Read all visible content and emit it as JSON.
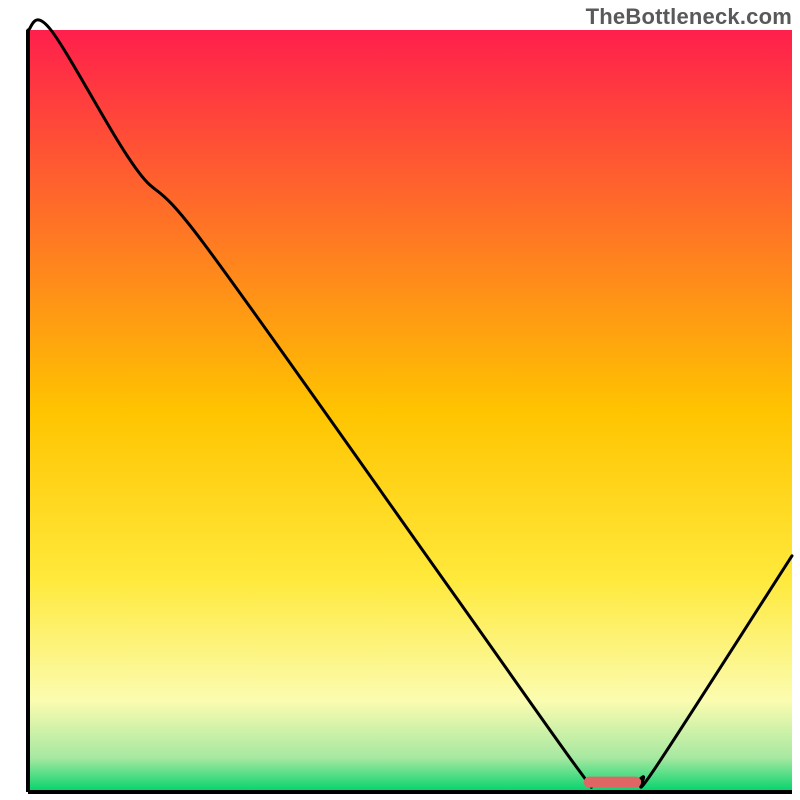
{
  "watermark": "TheBottleneck.com",
  "chart_data": {
    "type": "line",
    "title": "",
    "xlabel": "",
    "ylabel": "",
    "xlim": [
      0,
      100
    ],
    "ylim": [
      0,
      100
    ],
    "background": {
      "gradient_type": "vertical",
      "stops": [
        {
          "offset": 0.0,
          "color": "#ff1f4c"
        },
        {
          "offset": 0.5,
          "color": "#ffc400"
        },
        {
          "offset": 0.72,
          "color": "#ffe93b"
        },
        {
          "offset": 0.88,
          "color": "#fbfcb0"
        },
        {
          "offset": 0.955,
          "color": "#a7e8a1"
        },
        {
          "offset": 1.0,
          "color": "#00d36b"
        }
      ]
    },
    "curve": {
      "name": "bottleneck-curve",
      "x": [
        0,
        3,
        14,
        23,
        55,
        72,
        74,
        79,
        80.5,
        82,
        100
      ],
      "y": [
        100,
        100,
        82,
        72,
        27,
        3,
        1.3,
        1.3,
        2.0,
        3.0,
        31
      ]
    },
    "marker": {
      "shape": "rounded-bar",
      "x_center": 76.5,
      "width": 7.5,
      "y": 1.3,
      "color": "#e06666"
    },
    "axes": {
      "left": {
        "visible": true,
        "color": "#000000",
        "ticks": []
      },
      "bottom": {
        "visible": true,
        "color": "#000000",
        "ticks": []
      }
    }
  }
}
